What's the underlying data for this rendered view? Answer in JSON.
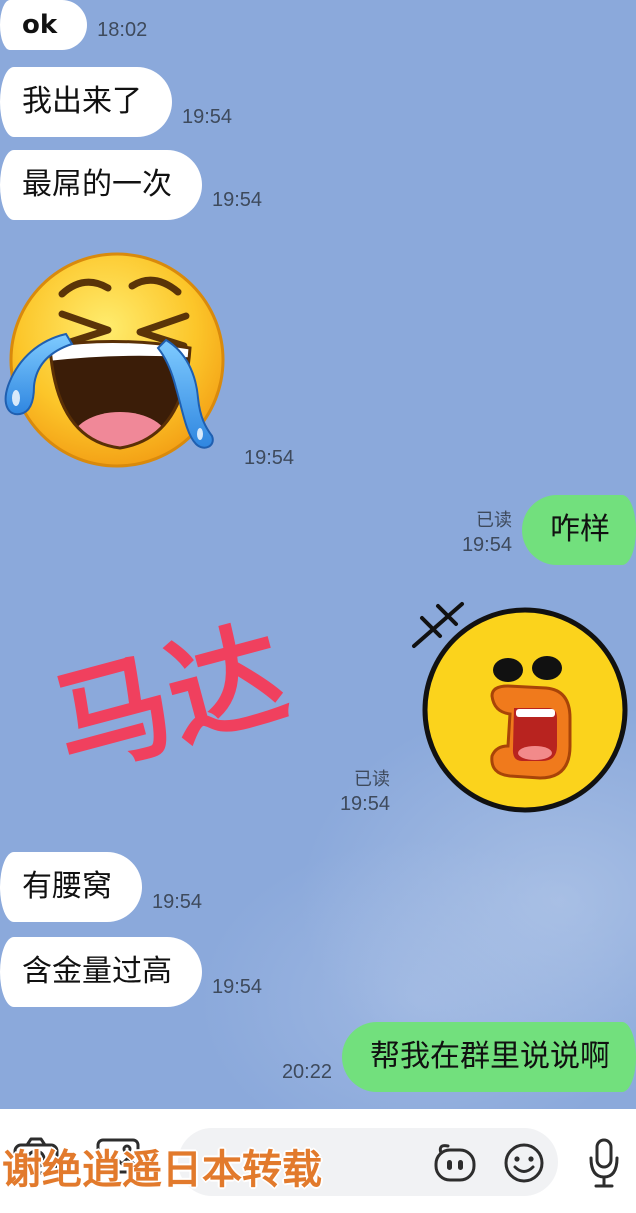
{
  "colors": {
    "background": "#8ba9db",
    "incoming_bubble": "#ffffff",
    "outgoing_bubble": "#72e07d",
    "timestamp": "#3e4a5c",
    "annotation": "#f0405e",
    "watermark": "#e27a2c"
  },
  "messages": [
    {
      "outgoing": false,
      "text": "ok",
      "time": "18:02"
    },
    {
      "outgoing": false,
      "text": "我出来了",
      "time": "19:54"
    },
    {
      "outgoing": false,
      "text": "最屌的一次",
      "time": "19:54"
    },
    {
      "outgoing": false,
      "sticker_icon": "face-with-tears-of-joy-icon",
      "time": "19:54"
    },
    {
      "outgoing": true,
      "text": "咋样",
      "read_status": "已读",
      "time": "19:54"
    },
    {
      "outgoing": true,
      "sticker_icon": "shocked-chick-face-icon",
      "read_status": "已读",
      "time": "19:54"
    },
    {
      "outgoing": false,
      "text": "有腰窝",
      "time": "19:54"
    },
    {
      "outgoing": false,
      "text": "含金量过高",
      "time": "19:54"
    },
    {
      "outgoing": true,
      "text": "帮我在群里说说啊",
      "time": "20:22"
    }
  ],
  "annotation_text": "马达",
  "input_bar": {
    "value": "",
    "icons": [
      "camera-icon",
      "image-icon",
      "ai-chat-icon",
      "emoji-icon",
      "microphone-icon"
    ]
  },
  "watermark_text": "谢绝逍遥日本转载"
}
